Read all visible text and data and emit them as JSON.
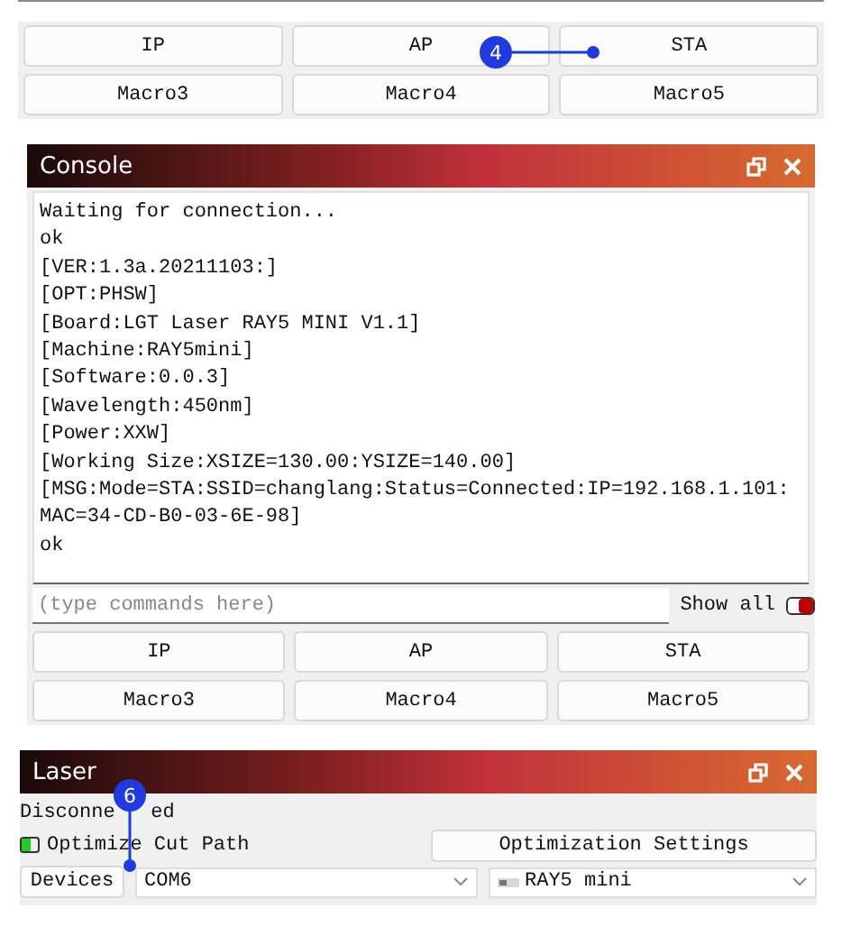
{
  "top_buttons": [
    "IP",
    "AP",
    "STA",
    "Macro3",
    "Macro4",
    "Macro5"
  ],
  "console": {
    "title": "Console",
    "lines": [
      "Waiting for connection...",
      "ok",
      "[VER:1.3a.20211103:]",
      "[OPT:PHSW]",
      "[Board:LGT Laser RAY5 MINI V1.1]",
      "[Machine:RAY5mini]",
      "[Software:0.0.3]",
      "[Wavelength:450nm]",
      "[Power:XXW]",
      "[Working Size:XSIZE=130.00:YSIZE=140.00]",
      "[MSG:Mode=STA:SSID=changlang:Status=Connected:IP=192.168.1.101:",
      "MAC=34-CD-B0-03-6E-98]",
      "ok"
    ],
    "command": {
      "placeholder": "(type commands here)"
    },
    "show_all": {
      "label": "Show all",
      "on": true
    },
    "buttons": [
      "IP",
      "AP",
      "STA",
      "Macro3",
      "Macro4",
      "Macro5"
    ]
  },
  "laser": {
    "title": "Laser",
    "status": [
      "Disconne",
      "ed"
    ],
    "optimize": {
      "label": "Optimize Cut Path",
      "on": false
    },
    "optimization_button": "Optimization Settings",
    "devices_button": "Devices",
    "port": "COM6",
    "machine": "RAY5 mini"
  },
  "callouts": [
    {
      "label": "4"
    },
    {
      "label": "6"
    }
  ]
}
